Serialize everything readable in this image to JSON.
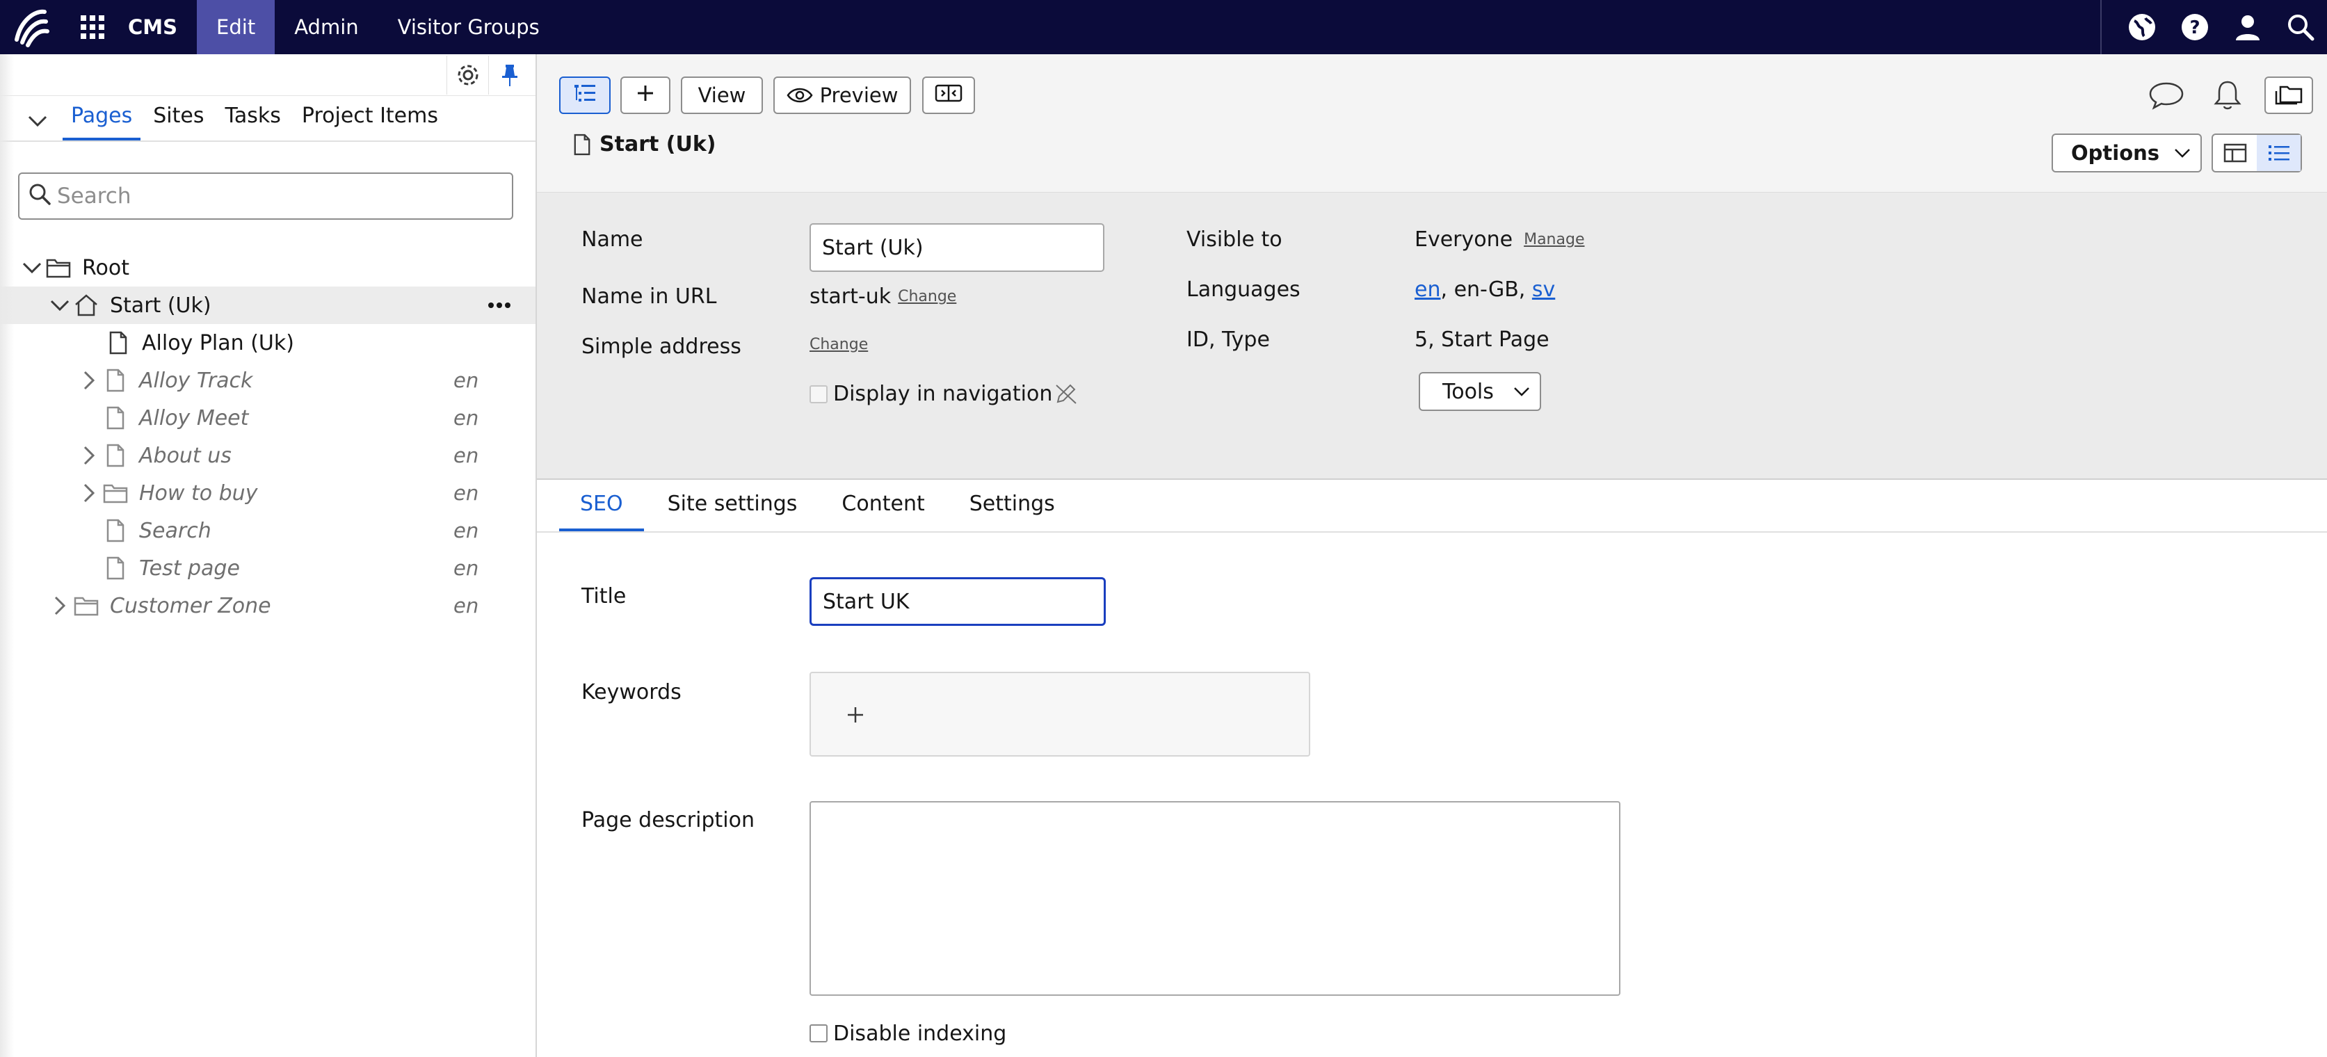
{
  "topbar": {
    "product": "CMS",
    "nav": [
      "Edit",
      "Admin",
      "Visitor Groups"
    ],
    "active": "Edit",
    "icons": [
      "globe-icon",
      "help-icon",
      "user-icon",
      "search-icon"
    ]
  },
  "navpane": {
    "tabs": [
      "Pages",
      "Sites",
      "Tasks",
      "Project Items"
    ],
    "active_tab": "Pages",
    "search_placeholder": "Search",
    "tree": [
      {
        "label": "Root",
        "level": 0,
        "icon": "folder",
        "expanded": true,
        "italic": false,
        "lang": ""
      },
      {
        "label": "Start (Uk)",
        "level": 1,
        "icon": "home",
        "expanded": true,
        "italic": false,
        "lang": "",
        "selected": true
      },
      {
        "label": "Alloy Plan (Uk)",
        "level": 2,
        "icon": "page",
        "expander": false,
        "italic": false,
        "lang": ""
      },
      {
        "label": "Alloy Track",
        "level": 2,
        "icon": "page",
        "expander": true,
        "italic": true,
        "lang": "en"
      },
      {
        "label": "Alloy Meet",
        "level": 2,
        "icon": "page",
        "expander": false,
        "italic": true,
        "lang": "en"
      },
      {
        "label": "About us",
        "level": 2,
        "icon": "page",
        "expander": true,
        "italic": true,
        "lang": "en"
      },
      {
        "label": "How to buy",
        "level": 2,
        "icon": "folder",
        "expander": true,
        "italic": true,
        "lang": "en"
      },
      {
        "label": "Search",
        "level": 2,
        "icon": "page",
        "expander": false,
        "italic": true,
        "lang": "en"
      },
      {
        "label": "Test page",
        "level": 2,
        "icon": "page",
        "expander": false,
        "italic": true,
        "lang": "en"
      },
      {
        "label": "Customer Zone",
        "level": 1,
        "icon": "folder",
        "expander": true,
        "italic": true,
        "lang": "en"
      }
    ]
  },
  "toolbar": {
    "view_label": "View",
    "preview_label": "Preview",
    "page_title": "Start (Uk)",
    "options_label": "Options"
  },
  "properties": {
    "name_label": "Name",
    "name_value": "Start (Uk)",
    "name_in_url_label": "Name in URL",
    "name_in_url_value": "start-uk",
    "change_label": "Change",
    "simple_address_label": "Simple address",
    "display_in_navigation_label": "Display in navigation",
    "visible_to_label": "Visible to",
    "visible_to_value": "Everyone",
    "manage_label": "Manage",
    "languages_label": "Languages",
    "languages": [
      "en",
      "en-GB",
      "sv"
    ],
    "id_type_label": "ID, Type",
    "id_type_value": "5, Start Page",
    "tools_label": "Tools"
  },
  "tabs": [
    "SEO",
    "Site settings",
    "Content",
    "Settings"
  ],
  "active_tab": "SEO",
  "seo": {
    "title_label": "Title",
    "title_value": "Start UK",
    "keywords_label": "Keywords",
    "page_description_label": "Page description",
    "disable_indexing_label": "Disable indexing"
  },
  "colors": {
    "topbar": "#0b0b3a",
    "active_nav": "#4d4fa6",
    "accent": "#1a5fd1"
  }
}
